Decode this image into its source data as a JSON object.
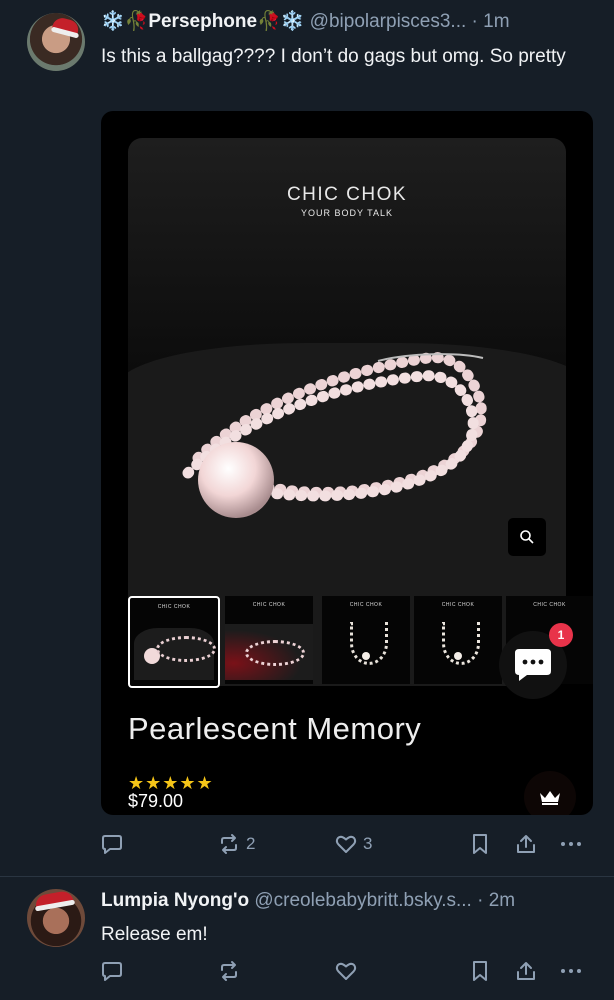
{
  "post1": {
    "display_name": "❄️🥀Persephone🥀❄️",
    "handle": "@bipolarpisces3...",
    "time": "· 1m",
    "text": "Is this a ballgag???? I don’t do gags but omg. So pretty",
    "embed": {
      "brand": "CHIC CHOK",
      "tagline": "YOUR BODY TALK",
      "thumb_label": "CHIC CHOK",
      "product_title": "Pearlescent Memory",
      "stars": "★★★★★",
      "price": "$79.00",
      "chat_badge": "1"
    },
    "actions": {
      "reply_count": "",
      "repost_count": "2",
      "like_count": "3"
    }
  },
  "post2": {
    "display_name": "Lumpia Nyong'o",
    "handle": "@creolebabybritt.bsky.s...",
    "time": "· 2m",
    "text": "Release em!"
  },
  "icons": {
    "reply": "reply-icon",
    "repost": "repost-icon",
    "like": "heart-icon",
    "bookmark": "bookmark-icon",
    "share": "share-icon",
    "more": "more-icon",
    "zoom": "search-icon",
    "chat": "chat-icon",
    "crown": "crown-icon"
  },
  "colors": {
    "background": "#161e27",
    "muted": "#8fa0b4",
    "text": "#f1f3f5",
    "star": "#f5c518",
    "badge": "#e8334a"
  }
}
